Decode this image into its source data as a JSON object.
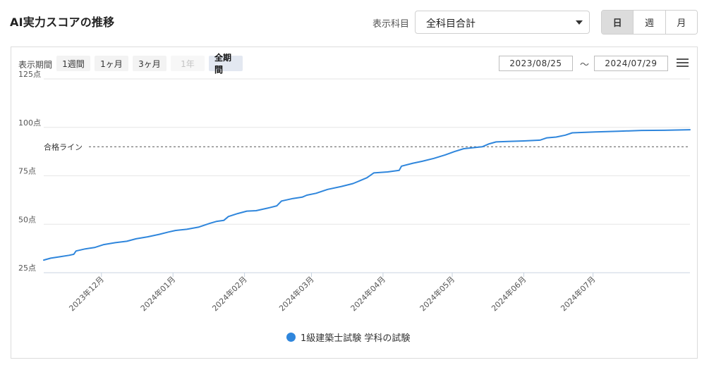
{
  "header": {
    "title": "AI実力スコアの推移",
    "subject_label": "表示科目",
    "subject_value": "全科目合計",
    "granularity": [
      {
        "label": "日",
        "active": true
      },
      {
        "label": "週",
        "active": false
      },
      {
        "label": "月",
        "active": false
      }
    ]
  },
  "range_selector": {
    "label": "表示期間",
    "buttons": [
      {
        "label": "1週間",
        "state": "normal"
      },
      {
        "label": "1ヶ月",
        "state": "normal"
      },
      {
        "label": "3ヶ月",
        "state": "normal"
      },
      {
        "label": "1年",
        "state": "disabled"
      },
      {
        "label": "全期間",
        "state": "active"
      }
    ],
    "from": "2023/08/25",
    "tilde": "～",
    "to": "2024/07/29"
  },
  "colors": {
    "series": "#2f86dc",
    "grid": "#e6e6e6",
    "pass_line": "#555555"
  },
  "chart_data": {
    "type": "line",
    "x_axis_type": "date",
    "xlim": [
      "2023-11-06",
      "2024-08-12"
    ],
    "ylim": [
      25,
      125
    ],
    "y_ticks": [
      {
        "value": 25,
        "label": "25点"
      },
      {
        "value": 50,
        "label": "50点"
      },
      {
        "value": 75,
        "label": "75点"
      },
      {
        "value": 100,
        "label": "100点"
      },
      {
        "value": 125,
        "label": "125点"
      }
    ],
    "x_ticks": [
      {
        "date": "2023-12-01",
        "label": "2023年12月"
      },
      {
        "date": "2024-01-01",
        "label": "2024年01月"
      },
      {
        "date": "2024-02-01",
        "label": "2024年02月"
      },
      {
        "date": "2024-03-01",
        "label": "2024年03月"
      },
      {
        "date": "2024-04-01",
        "label": "2024年04月"
      },
      {
        "date": "2024-05-01",
        "label": "2024年05月"
      },
      {
        "date": "2024-06-01",
        "label": "2024年06月"
      },
      {
        "date": "2024-07-01",
        "label": "2024年07月"
      }
    ],
    "pass_line": {
      "value": 90,
      "label": "合格ライン"
    },
    "series": [
      {
        "name": "1級建築士試験 学科の試験",
        "points": [
          [
            "2023-11-06",
            31.5
          ],
          [
            "2023-11-09",
            32.5
          ],
          [
            "2023-11-13",
            33.2
          ],
          [
            "2023-11-17",
            34.0
          ],
          [
            "2023-11-19",
            34.5
          ],
          [
            "2023-11-20",
            36.2
          ],
          [
            "2023-11-24",
            37.3
          ],
          [
            "2023-11-28",
            38.0
          ],
          [
            "2023-12-02",
            39.5
          ],
          [
            "2023-12-07",
            40.5
          ],
          [
            "2023-12-12",
            41.2
          ],
          [
            "2023-12-16",
            42.5
          ],
          [
            "2023-12-21",
            43.5
          ],
          [
            "2023-12-26",
            44.8
          ],
          [
            "2023-12-30",
            46.0
          ],
          [
            "2024-01-02",
            46.8
          ],
          [
            "2024-01-07",
            47.4
          ],
          [
            "2024-01-12",
            48.5
          ],
          [
            "2024-01-17",
            50.5
          ],
          [
            "2024-01-20",
            51.5
          ],
          [
            "2024-01-23",
            52.0
          ],
          [
            "2024-01-25",
            54.0
          ],
          [
            "2024-01-29",
            55.5
          ],
          [
            "2024-02-02",
            56.8
          ],
          [
            "2024-02-06",
            57.0
          ],
          [
            "2024-02-11",
            58.3
          ],
          [
            "2024-02-15",
            59.5
          ],
          [
            "2024-02-17",
            62.0
          ],
          [
            "2024-02-22",
            63.3
          ],
          [
            "2024-02-26",
            64.0
          ],
          [
            "2024-02-28",
            65.0
          ],
          [
            "2024-03-03",
            66.0
          ],
          [
            "2024-03-08",
            68.0
          ],
          [
            "2024-03-14",
            69.5
          ],
          [
            "2024-03-19",
            71.0
          ],
          [
            "2024-03-22",
            72.5
          ],
          [
            "2024-03-25",
            74.0
          ],
          [
            "2024-03-28",
            76.5
          ],
          [
            "2024-04-03",
            77.0
          ],
          [
            "2024-04-08",
            77.8
          ],
          [
            "2024-04-09",
            80.0
          ],
          [
            "2024-04-14",
            81.5
          ],
          [
            "2024-04-18",
            82.5
          ],
          [
            "2024-04-23",
            84.0
          ],
          [
            "2024-04-28",
            85.8
          ],
          [
            "2024-05-02",
            87.5
          ],
          [
            "2024-05-06",
            89.0
          ],
          [
            "2024-05-10",
            89.5
          ],
          [
            "2024-05-14",
            90.0
          ],
          [
            "2024-05-17",
            91.5
          ],
          [
            "2024-05-20",
            92.5
          ],
          [
            "2024-05-25",
            92.7
          ],
          [
            "2024-06-01",
            93.0
          ],
          [
            "2024-06-08",
            93.4
          ],
          [
            "2024-06-11",
            94.6
          ],
          [
            "2024-06-15",
            95.0
          ],
          [
            "2024-06-19",
            96.0
          ],
          [
            "2024-06-22",
            97.2
          ],
          [
            "2024-07-02",
            97.6
          ],
          [
            "2024-07-12",
            98.0
          ],
          [
            "2024-07-22",
            98.4
          ],
          [
            "2024-08-01",
            98.5
          ],
          [
            "2024-08-12",
            98.8
          ]
        ]
      }
    ]
  }
}
